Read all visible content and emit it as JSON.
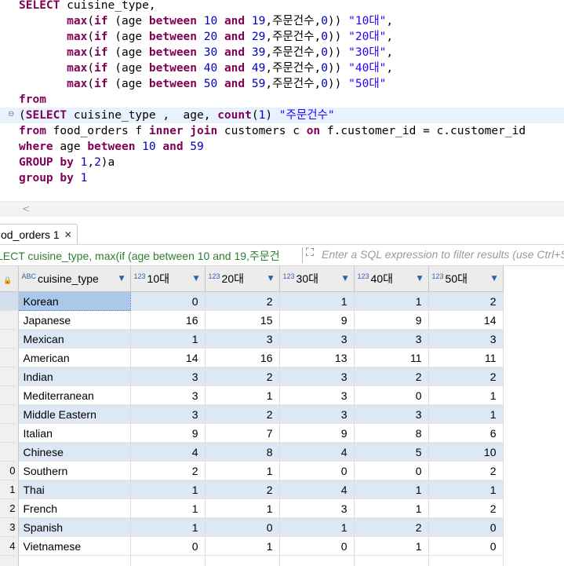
{
  "editor": {
    "lines": [
      [
        {
          "t": "SELECT",
          "c": "kw"
        },
        {
          "t": " cuisine_type,"
        }
      ],
      [
        {
          "t": "       "
        },
        {
          "t": "max",
          "c": "kw"
        },
        {
          "t": "("
        },
        {
          "t": "if",
          "c": "kw"
        },
        {
          "t": " (age "
        },
        {
          "t": "between",
          "c": "kw"
        },
        {
          "t": " "
        },
        {
          "t": "10",
          "c": "num"
        },
        {
          "t": " "
        },
        {
          "t": "and",
          "c": "kw"
        },
        {
          "t": " "
        },
        {
          "t": "19",
          "c": "num"
        },
        {
          "t": ",주문건수,"
        },
        {
          "t": "0",
          "c": "num"
        },
        {
          "t": ")) "
        },
        {
          "t": "\"10대\"",
          "c": "str"
        },
        {
          "t": ","
        }
      ],
      [
        {
          "t": "       "
        },
        {
          "t": "max",
          "c": "kw"
        },
        {
          "t": "("
        },
        {
          "t": "if",
          "c": "kw"
        },
        {
          "t": " (age "
        },
        {
          "t": "between",
          "c": "kw"
        },
        {
          "t": " "
        },
        {
          "t": "20",
          "c": "num"
        },
        {
          "t": " "
        },
        {
          "t": "and",
          "c": "kw"
        },
        {
          "t": " "
        },
        {
          "t": "29",
          "c": "num"
        },
        {
          "t": ",주문건수,"
        },
        {
          "t": "0",
          "c": "num"
        },
        {
          "t": ")) "
        },
        {
          "t": "\"20대\"",
          "c": "str"
        },
        {
          "t": ","
        }
      ],
      [
        {
          "t": "       "
        },
        {
          "t": "max",
          "c": "kw"
        },
        {
          "t": "("
        },
        {
          "t": "if",
          "c": "kw"
        },
        {
          "t": " (age "
        },
        {
          "t": "between",
          "c": "kw"
        },
        {
          "t": " "
        },
        {
          "t": "30",
          "c": "num"
        },
        {
          "t": " "
        },
        {
          "t": "and",
          "c": "kw"
        },
        {
          "t": " "
        },
        {
          "t": "39",
          "c": "num"
        },
        {
          "t": ",주문건수,"
        },
        {
          "t": "0",
          "c": "num"
        },
        {
          "t": ")) "
        },
        {
          "t": "\"30대\"",
          "c": "str"
        },
        {
          "t": ","
        }
      ],
      [
        {
          "t": "       "
        },
        {
          "t": "max",
          "c": "kw"
        },
        {
          "t": "("
        },
        {
          "t": "if",
          "c": "kw"
        },
        {
          "t": " (age "
        },
        {
          "t": "between",
          "c": "kw"
        },
        {
          "t": " "
        },
        {
          "t": "40",
          "c": "num"
        },
        {
          "t": " "
        },
        {
          "t": "and",
          "c": "kw"
        },
        {
          "t": " "
        },
        {
          "t": "49",
          "c": "num"
        },
        {
          "t": ",주문건수,"
        },
        {
          "t": "0",
          "c": "num"
        },
        {
          "t": ")) "
        },
        {
          "t": "\"40대\"",
          "c": "str"
        },
        {
          "t": ","
        }
      ],
      [
        {
          "t": "       "
        },
        {
          "t": "max",
          "c": "kw"
        },
        {
          "t": "("
        },
        {
          "t": "if",
          "c": "kw"
        },
        {
          "t": " (age "
        },
        {
          "t": "between",
          "c": "kw"
        },
        {
          "t": " "
        },
        {
          "t": "50",
          "c": "num"
        },
        {
          "t": " "
        },
        {
          "t": "and",
          "c": "kw"
        },
        {
          "t": " "
        },
        {
          "t": "59",
          "c": "num"
        },
        {
          "t": ",주문건수,"
        },
        {
          "t": "0",
          "c": "num"
        },
        {
          "t": ")) "
        },
        {
          "t": "\"50대\"",
          "c": "str"
        }
      ],
      [
        {
          "t": "from",
          "c": "kw"
        }
      ],
      [
        {
          "t": "("
        },
        {
          "t": "SELECT",
          "c": "kw"
        },
        {
          "t": " cuisine_type ,  age, "
        },
        {
          "t": "count",
          "c": "kw"
        },
        {
          "t": "("
        },
        {
          "t": "1",
          "c": "num"
        },
        {
          "t": ") "
        },
        {
          "t": "\"주문건수\"",
          "c": "str"
        }
      ],
      [
        {
          "t": "from",
          "c": "kw"
        },
        {
          "t": " food_orders f "
        },
        {
          "t": "inner",
          "c": "kw"
        },
        {
          "t": " "
        },
        {
          "t": "join",
          "c": "kw"
        },
        {
          "t": " customers c "
        },
        {
          "t": "on",
          "c": "kw"
        },
        {
          "t": " f.customer_id = c.customer_id"
        }
      ],
      [
        {
          "t": "where",
          "c": "kw"
        },
        {
          "t": " age "
        },
        {
          "t": "between",
          "c": "kw"
        },
        {
          "t": " "
        },
        {
          "t": "10",
          "c": "num"
        },
        {
          "t": " "
        },
        {
          "t": "and",
          "c": "kw"
        },
        {
          "t": " "
        },
        {
          "t": "59",
          "c": "num"
        }
      ],
      [
        {
          "t": "GROUP",
          "c": "kw"
        },
        {
          "t": " "
        },
        {
          "t": "by",
          "c": "kw"
        },
        {
          "t": " "
        },
        {
          "t": "1",
          "c": "num"
        },
        {
          "t": ","
        },
        {
          "t": "2",
          "c": "num"
        },
        {
          "t": ")a"
        }
      ],
      [
        {
          "t": "group",
          "c": "kw"
        },
        {
          "t": " "
        },
        {
          "t": "by",
          "c": "kw"
        },
        {
          "t": " "
        },
        {
          "t": "1",
          "c": "num"
        }
      ]
    ],
    "fold_marker": "⊖",
    "hscroll_left": "<"
  },
  "results": {
    "tab_label": "od_orders 1",
    "tab_close": "✕",
    "filter_query": "LECT cuisine_type, max(if (age between 10 and 19,주문건",
    "filter_icon": "⛶",
    "filter_placeholder": "Enter a SQL expression to filter results (use Ctrl+Space)",
    "columns": [
      {
        "type": "ABC",
        "name": "cuisine_type"
      },
      {
        "type": "123",
        "name": "10대"
      },
      {
        "type": "123",
        "name": "20대"
      },
      {
        "type": "123",
        "name": "30대"
      },
      {
        "type": "123",
        "name": "40대"
      },
      {
        "type": "123",
        "name": "50대"
      }
    ],
    "sort_glyph": "▼",
    "lock_glyph": "🔒",
    "rows": [
      {
        "num": "",
        "cells": [
          "Korean",
          "0",
          "2",
          "1",
          "1",
          "2"
        ]
      },
      {
        "num": "",
        "cells": [
          "Japanese",
          "16",
          "15",
          "9",
          "9",
          "14"
        ]
      },
      {
        "num": "",
        "cells": [
          "Mexican",
          "1",
          "3",
          "3",
          "3",
          "3"
        ]
      },
      {
        "num": "",
        "cells": [
          "American",
          "14",
          "16",
          "13",
          "11",
          "11"
        ]
      },
      {
        "num": "",
        "cells": [
          "Indian",
          "3",
          "2",
          "3",
          "2",
          "2"
        ]
      },
      {
        "num": "",
        "cells": [
          "Mediterranean",
          "3",
          "1",
          "3",
          "0",
          "1"
        ]
      },
      {
        "num": "",
        "cells": [
          "Middle Eastern",
          "3",
          "2",
          "3",
          "3",
          "1"
        ]
      },
      {
        "num": "",
        "cells": [
          "Italian",
          "9",
          "7",
          "9",
          "8",
          "6"
        ]
      },
      {
        "num": "",
        "cells": [
          "Chinese",
          "4",
          "8",
          "4",
          "5",
          "10"
        ]
      },
      {
        "num": "0",
        "cells": [
          "Southern",
          "2",
          "1",
          "0",
          "0",
          "2"
        ]
      },
      {
        "num": "1",
        "cells": [
          "Thai",
          "1",
          "2",
          "4",
          "1",
          "1"
        ]
      },
      {
        "num": "2",
        "cells": [
          "French",
          "1",
          "1",
          "3",
          "1",
          "2"
        ]
      },
      {
        "num": "3",
        "cells": [
          "Spanish",
          "1",
          "0",
          "1",
          "2",
          "0"
        ]
      },
      {
        "num": "4",
        "cells": [
          "Vietnamese",
          "0",
          "1",
          "0",
          "1",
          "0"
        ]
      }
    ]
  }
}
